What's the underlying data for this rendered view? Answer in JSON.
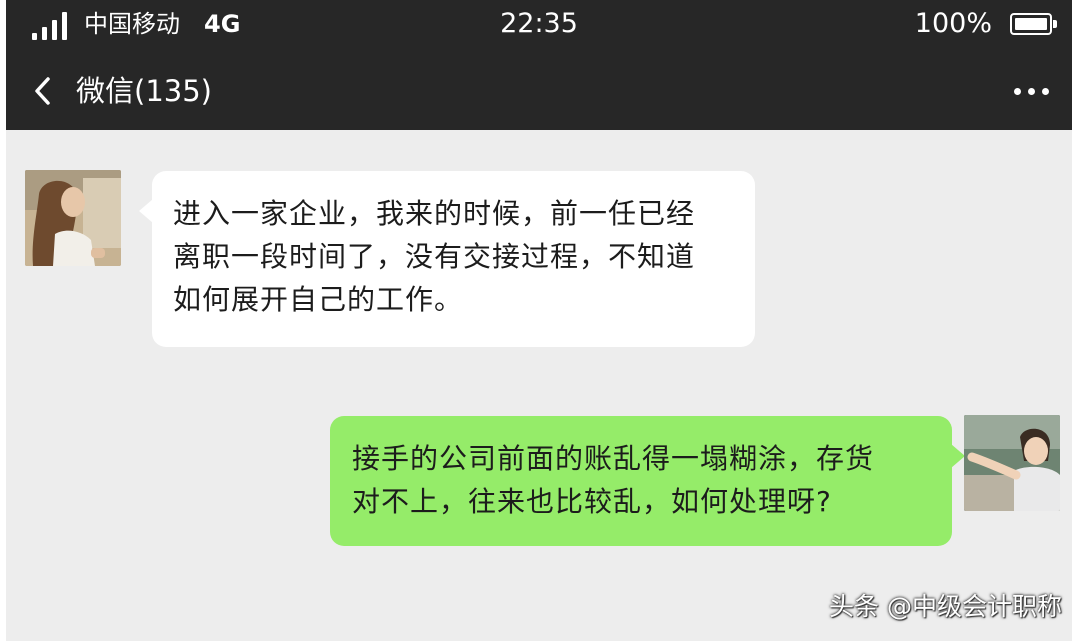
{
  "status_bar": {
    "carrier": "中国移动",
    "network": "4G",
    "time": "22:35",
    "battery": "100%"
  },
  "nav": {
    "back_icon": "chevron-left-icon",
    "title": "微信(135)",
    "more_icon": "more-dots-icon"
  },
  "messages": [
    {
      "side": "left",
      "lines": [
        "进入一家企业，我来的时候，前一任已经",
        "离职一段时间了，没有交接过程，不知道",
        "如何展开自己的工作。"
      ]
    },
    {
      "side": "right",
      "lines": [
        "接手的公司前面的账乱得一塌糊涂，存货",
        "对不上，往来也比较乱，如何处理呀?"
      ]
    }
  ],
  "watermark": "头条 @中级会计职称",
  "colors": {
    "header_bg": "#272727",
    "chat_bg": "#ededed",
    "incoming_bubble": "#ffffff",
    "outgoing_bubble": "#95ec69"
  }
}
